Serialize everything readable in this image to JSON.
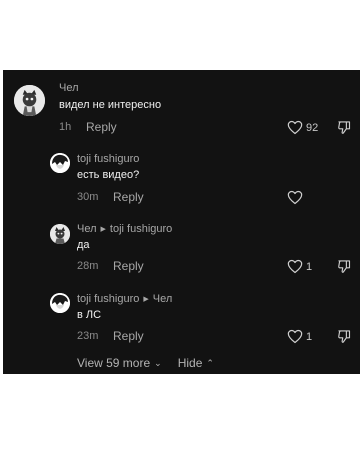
{
  "comments": [
    {
      "author": "Чел",
      "text": "видел не интересно",
      "time": "1h",
      "reply_label": "Reply",
      "likes": "92"
    }
  ],
  "replies": [
    {
      "author": "toji fushiguro",
      "reply_to": "",
      "text": "есть видео?",
      "time": "30m",
      "reply_label": "Reply",
      "likes": ""
    },
    {
      "author": "Чел",
      "reply_to": "toji fushiguro",
      "text": "да",
      "time": "28m",
      "reply_label": "Reply",
      "likes": "1"
    },
    {
      "author": "toji fushiguro",
      "reply_to": "Чел",
      "text": "в ЛС",
      "time": "23m",
      "reply_label": "Reply",
      "likes": "1"
    }
  ],
  "footer": {
    "view_more": "View 59 more",
    "hide": "Hide"
  },
  "icons": {
    "like": "heart-outline-icon",
    "dislike": "thumbs-down-outline-icon",
    "reply_arrow": "triangle-right-icon",
    "view_more_chevron": "chevron-down-icon",
    "hide_chevron": "chevron-up-icon"
  },
  "colors": {
    "background": "#121212",
    "text": "#f1f1f1",
    "muted": "#a7a7a7"
  }
}
